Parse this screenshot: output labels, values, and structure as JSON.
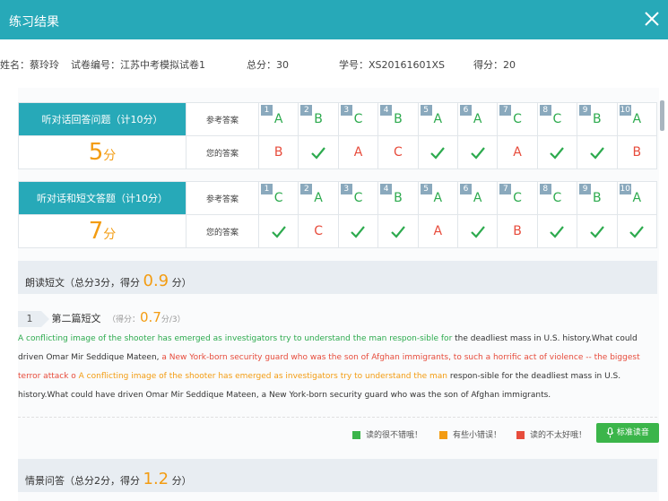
{
  "window": {
    "title": "练习结果"
  },
  "info": {
    "name": "姓名：蔡玲玲",
    "paper": "试卷编号：江苏中考模拟试卷1",
    "total": "总分：30",
    "student_id": "学号：XS20161601XS",
    "score": "得分：20"
  },
  "labels": {
    "ref": "参考答案",
    "yours": "您的答案",
    "unit": "分"
  },
  "sections": [
    {
      "title": "听对话回答问题（计10分）",
      "score": "5",
      "items": [
        {
          "n": "1",
          "ref": "A",
          "yours": "B",
          "correct": false
        },
        {
          "n": "2",
          "ref": "B",
          "yours": "",
          "correct": true
        },
        {
          "n": "3",
          "ref": "C",
          "yours": "A",
          "correct": false
        },
        {
          "n": "4",
          "ref": "B",
          "yours": "C",
          "correct": false
        },
        {
          "n": "5",
          "ref": "A",
          "yours": "",
          "correct": true
        },
        {
          "n": "6",
          "ref": "A",
          "yours": "",
          "correct": true
        },
        {
          "n": "7",
          "ref": "C",
          "yours": "A",
          "correct": false
        },
        {
          "n": "8",
          "ref": "C",
          "yours": "",
          "correct": true
        },
        {
          "n": "9",
          "ref": "B",
          "yours": "",
          "correct": true
        },
        {
          "n": "10",
          "ref": "A",
          "yours": "B",
          "correct": false
        }
      ]
    },
    {
      "title": "听对话和短文答题（计10分）",
      "score": "7",
      "items": [
        {
          "n": "1",
          "ref": "C",
          "yours": "",
          "correct": true
        },
        {
          "n": "2",
          "ref": "A",
          "yours": "C",
          "correct": false
        },
        {
          "n": "3",
          "ref": "C",
          "yours": "",
          "correct": true
        },
        {
          "n": "4",
          "ref": "B",
          "yours": "",
          "correct": true
        },
        {
          "n": "5",
          "ref": "A",
          "yours": "A",
          "correct": false
        },
        {
          "n": "6",
          "ref": "A",
          "yours": "",
          "correct": true
        },
        {
          "n": "7",
          "ref": "C",
          "yours": "B",
          "correct": false
        },
        {
          "n": "8",
          "ref": "C",
          "yours": "",
          "correct": true
        },
        {
          "n": "9",
          "ref": "B",
          "yours": "",
          "correct": true
        },
        {
          "n": "10",
          "ref": "A",
          "yours": "",
          "correct": true
        }
      ]
    }
  ],
  "reading": {
    "header_pre": "朗读短文（总分3分，得分",
    "header_score": "0.9",
    "header_post": "分）",
    "item_num": "1",
    "item_title": "第二篇短文",
    "item_score_pre": "（得分：",
    "item_score": "0.7",
    "item_score_post": "分/3）",
    "passage": [
      {
        "c": "g",
        "t": "A conflicting image of the shooter has emerged as investigators try to understand the man respon-sible for "
      },
      {
        "c": "d",
        "t": "the deadliest mass in U.S. history.What could   driven Omar Mir Seddique Mateen, "
      },
      {
        "c": "r",
        "t": "a New York-born security guard who was the son of Afghan immigrants, to such a horrific act of violence -- the biggest terror attack o"
      },
      {
        "c": "o",
        "t": " A conflicting image of the shooter has emerged as investigators try to understand the man "
      },
      {
        "c": "d",
        "t": "respon-sible for the deadliest mass in U.S. history.What could have driven Omar Mir Seddique Mateen, a New York-born security guard who was the son of Afghan immigrants."
      }
    ],
    "legend": [
      {
        "color": "#3bb54a",
        "label": "读的很不错哦！"
      },
      {
        "color": "#f39c12",
        "label": "有些小错误！"
      },
      {
        "color": "#e74c3c",
        "label": "读的不太好哦！"
      }
    ],
    "std_button": "标准读音"
  },
  "scene": {
    "header_pre": "情景问答（总分2分，得分",
    "header_score": "1.2",
    "header_post": "分）"
  },
  "colors": {
    "accent": "#27a9b8",
    "score": "#f39c12",
    "correct": "#2daa4e",
    "wrong": "#e74c3c"
  }
}
